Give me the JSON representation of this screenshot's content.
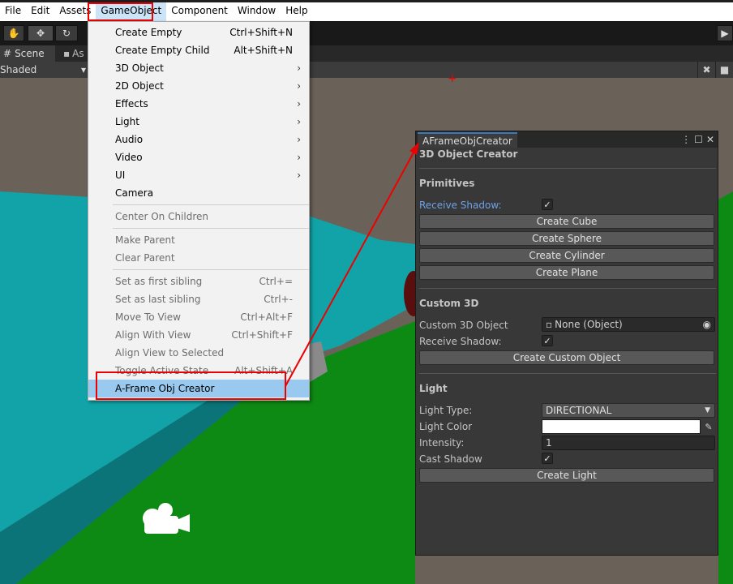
{
  "menubar": {
    "items": [
      "File",
      "Edit",
      "Assets",
      "GameObject",
      "Component",
      "Window",
      "Help"
    ]
  },
  "tabs": {
    "scene_label": "Scene",
    "asset_label": "As"
  },
  "scenebar": {
    "shading_mode": "Shaded"
  },
  "dropdown": {
    "create_empty": {
      "label": "Create Empty",
      "shortcut": "Ctrl+Shift+N"
    },
    "create_empty_child": {
      "label": "Create Empty Child",
      "shortcut": "Alt+Shift+N"
    },
    "obj_3d": "3D Object",
    "obj_2d": "2D Object",
    "effects": "Effects",
    "light": "Light",
    "audio": "Audio",
    "video": "Video",
    "ui": "UI",
    "camera": "Camera",
    "center_on_children": "Center On Children",
    "make_parent": "Make Parent",
    "clear_parent": "Clear Parent",
    "set_first_sibling": {
      "label": "Set as first sibling",
      "shortcut": "Ctrl+="
    },
    "set_last_sibling": {
      "label": "Set as last sibling",
      "shortcut": "Ctrl+-"
    },
    "move_to_view": {
      "label": "Move To View",
      "shortcut": "Ctrl+Alt+F"
    },
    "align_with_view": {
      "label": "Align With View",
      "shortcut": "Ctrl+Shift+F"
    },
    "align_view_to_selected": "Align View to Selected",
    "toggle_active_state": {
      "label": "Toggle Active State",
      "shortcut": "Alt+Shift+A"
    },
    "aframe_obj_creator": "A-Frame Obj Creator"
  },
  "creator": {
    "tab_title": "AFrameObjCreator",
    "title": "3D Object Creator",
    "primitives": {
      "heading": "Primitives",
      "receive_shadow_label": "Receive Shadow:",
      "receive_shadow_checked": true,
      "create_cube": "Create Cube",
      "create_sphere": "Create Sphere",
      "create_cylinder": "Create Cylinder",
      "create_plane": "Create Plane"
    },
    "custom": {
      "heading": "Custom 3D",
      "object_label": "Custom 3D Object",
      "object_value": "None (Object)",
      "receive_shadow_label": "Receive Shadow:",
      "receive_shadow_checked": true,
      "create_button": "Create Custom Object"
    },
    "light": {
      "heading": "Light",
      "type_label": "Light Type:",
      "type_value": "DIRECTIONAL",
      "color_label": "Light Color",
      "color_value": "#ffffff",
      "intensity_label": "Intensity:",
      "intensity_value": "1",
      "cast_shadow_label": "Cast Shadow",
      "cast_shadow_checked": true,
      "create_button": "Create Light"
    }
  },
  "colors": {
    "sky": "#6a6259",
    "teal_plane": "#11a3a8",
    "green_plane": "#0d8a14",
    "highlight_red": "#ee0000",
    "menu_selection": "#99c9ef"
  }
}
